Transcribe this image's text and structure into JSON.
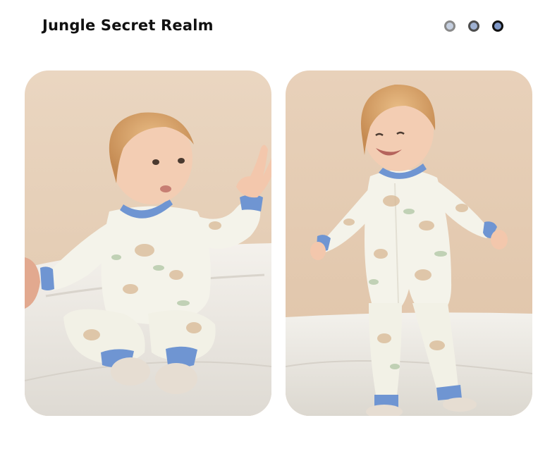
{
  "header": {
    "title": "Jungle Secret Realm"
  },
  "pagination": {
    "dots": 3,
    "active_index": 2
  },
  "colors": {
    "backdrop": "#e8d2bb",
    "bedding": "#efece6",
    "romper": "#f4f3ea",
    "trim": "#6f95d2",
    "hair": "#d6a26a",
    "skin": "#f3cdb3"
  },
  "photos": [
    {
      "subject": "baby-sitting-waving"
    },
    {
      "subject": "baby-standing-smiling"
    }
  ]
}
